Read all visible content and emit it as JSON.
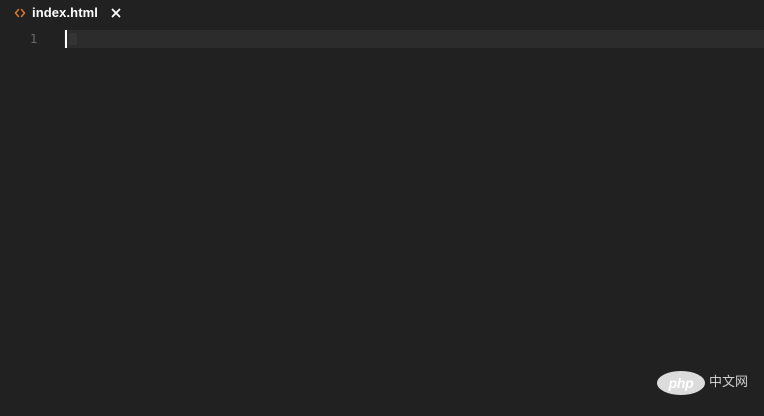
{
  "tab": {
    "label": "index.html",
    "file_icon": "code-brackets-icon",
    "close_icon": "close-icon",
    "icon_color": "#e37933"
  },
  "editor": {
    "line_numbers": [
      "1"
    ],
    "content": ""
  },
  "watermark": {
    "badge": "php",
    "text": "中文网"
  }
}
